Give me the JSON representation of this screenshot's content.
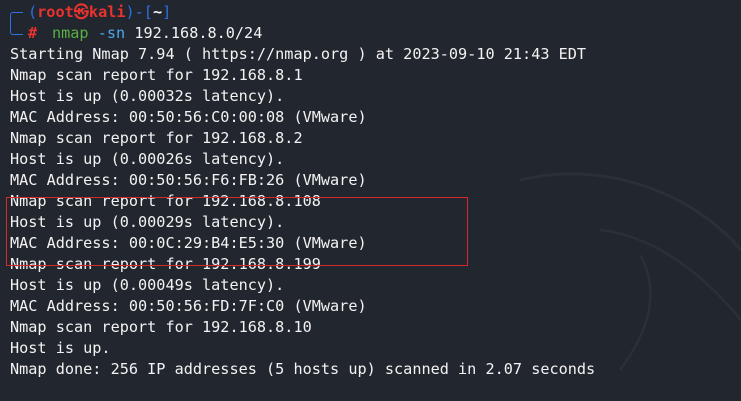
{
  "prompt": {
    "open_paren": "(",
    "user": "root",
    "at_symbol": "㉿",
    "host": "kali",
    "close_paren": ")-[",
    "dir": "~",
    "close_bracket": "]",
    "hash": "#"
  },
  "command": {
    "name": "nmap",
    "flag": "-sn",
    "arg": "192.168.8.0/24"
  },
  "output": [
    "Starting Nmap 7.94 ( https://nmap.org ) at 2023-09-10 21:43 EDT",
    "Nmap scan report for 192.168.8.1",
    "Host is up (0.00032s latency).",
    "MAC Address: 00:50:56:C0:00:08 (VMware)",
    "Nmap scan report for 192.168.8.2",
    "Host is up (0.00026s latency).",
    "MAC Address: 00:50:56:F6:FB:26 (VMware)",
    "Nmap scan report for 192.168.8.108",
    "Host is up (0.00029s latency).",
    "MAC Address: 00:0C:29:B4:E5:30 (VMware)",
    "Nmap scan report for 192.168.8.199",
    "Host is up (0.00049s latency).",
    "MAC Address: 00:50:56:FD:7F:C0 (VMware)",
    "Nmap scan report for 192.168.8.10",
    "Host is up.",
    "Nmap done: 256 IP addresses (5 hosts up) scanned in 2.07 seconds"
  ],
  "colors": {
    "background": "#22262e",
    "text": "#f3f3f3",
    "prompt_frame": "#2f6fe0",
    "prompt_user": "#e8332e",
    "command_name": "#5ab043",
    "command_flag": "#4ea7f0",
    "highlight_border": "#d62a2a"
  }
}
